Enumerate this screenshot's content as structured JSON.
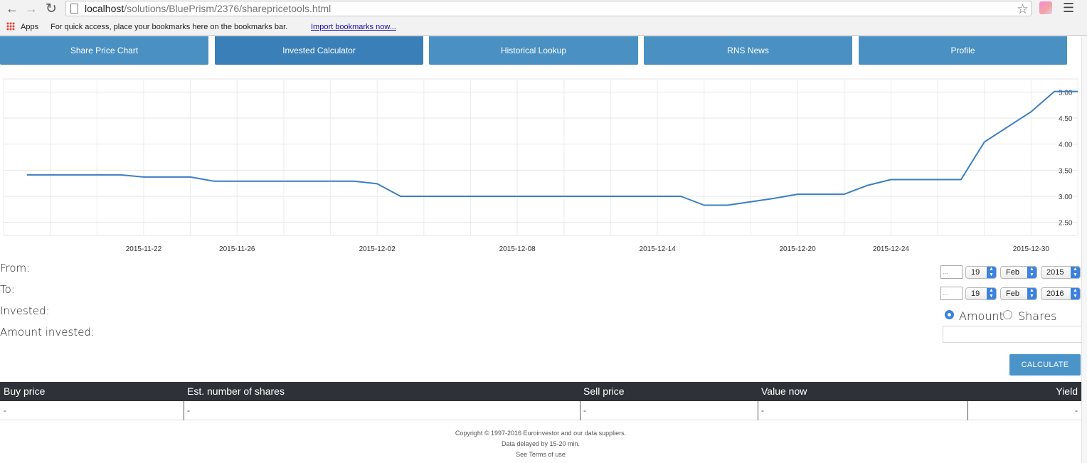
{
  "browser": {
    "url_host": "localhost",
    "url_path": "/solutions/BluePrism/2376/sharepricetools.html",
    "bookmarks_apps": "Apps",
    "bookmarks_hint": "For quick access, place your bookmarks here on the bookmarks bar.",
    "bookmarks_import": "Import bookmarks now..."
  },
  "tabs": [
    {
      "label": "Share Price Chart",
      "active": false
    },
    {
      "label": "Invested Calculator",
      "active": true
    },
    {
      "label": "Historical Lookup",
      "active": false
    },
    {
      "label": "RNS News",
      "active": false
    },
    {
      "label": "Profile",
      "active": false
    }
  ],
  "chart_data": {
    "type": "line",
    "x_ticks": [
      "2015-11-22",
      "2015-11-26",
      "2015-12-02",
      "2015-12-08",
      "2015-12-14",
      "2015-12-20",
      "2015-12-24",
      "2015-12-30"
    ],
    "y_ticks": [
      "5.00",
      "4.50",
      "4.00",
      "3.50",
      "3.00",
      "2.50"
    ],
    "ylim": [
      2.5,
      5.0
    ],
    "grid": true,
    "color": "#3a7fc1",
    "points": [
      {
        "x": "2015-11-17",
        "y": 3.41
      },
      {
        "x": "2015-11-21",
        "y": 3.41
      },
      {
        "x": "2015-11-22",
        "y": 3.37
      },
      {
        "x": "2015-11-24",
        "y": 3.37
      },
      {
        "x": "2015-11-25",
        "y": 3.29
      },
      {
        "x": "2015-12-01",
        "y": 3.29
      },
      {
        "x": "2015-12-02",
        "y": 3.24
      },
      {
        "x": "2015-12-03",
        "y": 3.0
      },
      {
        "x": "2015-12-15",
        "y": 3.0
      },
      {
        "x": "2015-12-16",
        "y": 2.83
      },
      {
        "x": "2015-12-17",
        "y": 2.83
      },
      {
        "x": "2015-12-19",
        "y": 2.96
      },
      {
        "x": "2015-12-20",
        "y": 3.04
      },
      {
        "x": "2015-12-22",
        "y": 3.04
      },
      {
        "x": "2015-12-23",
        "y": 3.21
      },
      {
        "x": "2015-12-24",
        "y": 3.32
      },
      {
        "x": "2015-12-27",
        "y": 3.32
      },
      {
        "x": "2015-12-28",
        "y": 4.04
      },
      {
        "x": "2015-12-30",
        "y": 4.62
      },
      {
        "x": "2015-12-31",
        "y": 5.01
      },
      {
        "x": "2016-01-01",
        "y": 5.01
      }
    ]
  },
  "form": {
    "from_label": "From:",
    "to_label": "To:",
    "invested_label": "Invested:",
    "amount_invested_label": "Amount invested:",
    "from": {
      "day": "19",
      "month": "Feb",
      "year": "2015"
    },
    "to": {
      "day": "19",
      "month": "Feb",
      "year": "2016"
    },
    "calendar_alt": "...",
    "radio_amount": "Amount",
    "radio_shares": "Shares",
    "selected": "Amount",
    "amount_value": "",
    "calculate_label": "CALCULATE"
  },
  "table": {
    "headers": [
      "Buy price",
      "Est. number of shares",
      "Sell price",
      "Value now",
      "Yield"
    ],
    "row": [
      "-",
      "-",
      "-",
      "-",
      "-"
    ]
  },
  "footer": {
    "line1": "Copyright © 1997-2016 Euroinvestor and our data suppliers.",
    "line2": "Data delayed by 15-20 min.",
    "line3": "See Terms of use"
  }
}
